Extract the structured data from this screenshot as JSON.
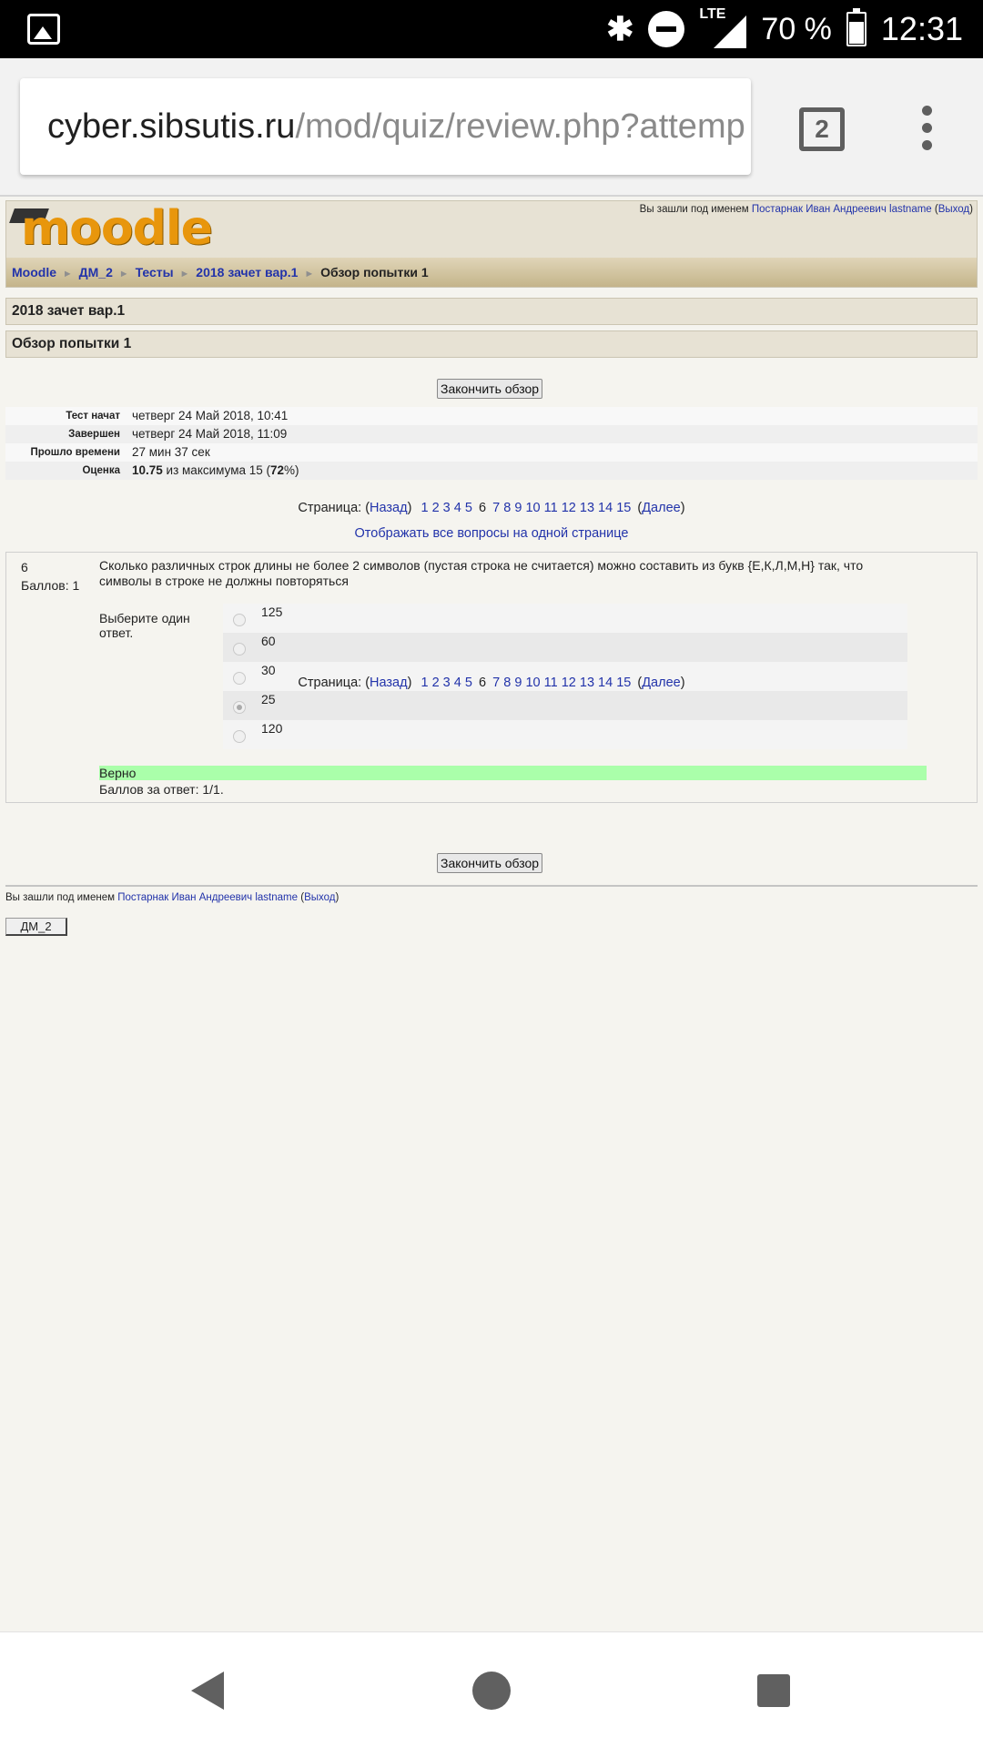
{
  "status_bar": {
    "battery_percent": "70 %",
    "time": "12:31",
    "network": "LTE",
    "icons": [
      "gallery-icon",
      "bluetooth-icon",
      "do-not-disturb-icon",
      "lte-signal-icon",
      "battery-icon"
    ]
  },
  "browser": {
    "url_host": "cyber.sibsutis.ru",
    "url_path": "/mod/quiz/review.php?attemp",
    "tab_count": "2"
  },
  "header": {
    "logo_text": "moodle",
    "login_prefix": "Вы зашли под именем ",
    "user_name": "Постарнак Иван Андреевич lastname",
    "open_paren": " (",
    "logout": "Выход",
    "close_paren": ")"
  },
  "breadcrumb": {
    "items": [
      "Moodle",
      "ДМ_2",
      "Тесты",
      "2018 зачет вар.1"
    ],
    "current": "Обзор попытки 1",
    "separator": "►"
  },
  "quiz": {
    "title": "2018 зачет вар.1",
    "review_title": "Обзор попытки 1",
    "finish_button": "Закончить обзор"
  },
  "summary": {
    "rows": [
      {
        "label": "Тест начат",
        "value": "четверг 24 Май 2018, 10:41"
      },
      {
        "label": "Завершен",
        "value": "четверг 24 Май 2018, 11:09"
      },
      {
        "label": "Прошло времени",
        "value": "27 мин 37 сек"
      }
    ],
    "grade_label": "Оценка",
    "grade_score": "10.75",
    "grade_mid": " из максимума 15 (",
    "grade_percent": "72",
    "grade_end": "%)"
  },
  "paging": {
    "label": "Страница: (",
    "prev": "Назад",
    "prev_close": ")",
    "pages_before": [
      "1",
      "2",
      "3",
      "4",
      "5"
    ],
    "current": "6",
    "pages_after": [
      "7",
      "8",
      "9",
      "10",
      "11",
      "12",
      "13",
      "14",
      "15"
    ],
    "next_open": "(",
    "next": "Далее",
    "next_close": ")",
    "show_all": "Отображать все вопросы на одной странице"
  },
  "question": {
    "number": "6",
    "marks": "Баллов: 1",
    "text": "Сколько различных строк длины не более 2 символов (пустая строка не считается) можно составить из букв {Е,К,Л,М,Н} так, что символы в строке не должны повторяться",
    "prompt": "Выберите один ответ.",
    "answers": [
      {
        "label": "125",
        "selected": false
      },
      {
        "label": "60",
        "selected": false
      },
      {
        "label": "30",
        "selected": false
      },
      {
        "label": "25",
        "selected": true
      },
      {
        "label": "120",
        "selected": false
      }
    ],
    "result": "Верно",
    "result_color": "#aaffaa",
    "points": "Баллов за ответ: 1/1."
  },
  "footer": {
    "course_button": "ДМ_2"
  },
  "colors": {
    "link": "#2233aa",
    "header_bg": "#e7e2d4",
    "logo": "#e8960c"
  }
}
